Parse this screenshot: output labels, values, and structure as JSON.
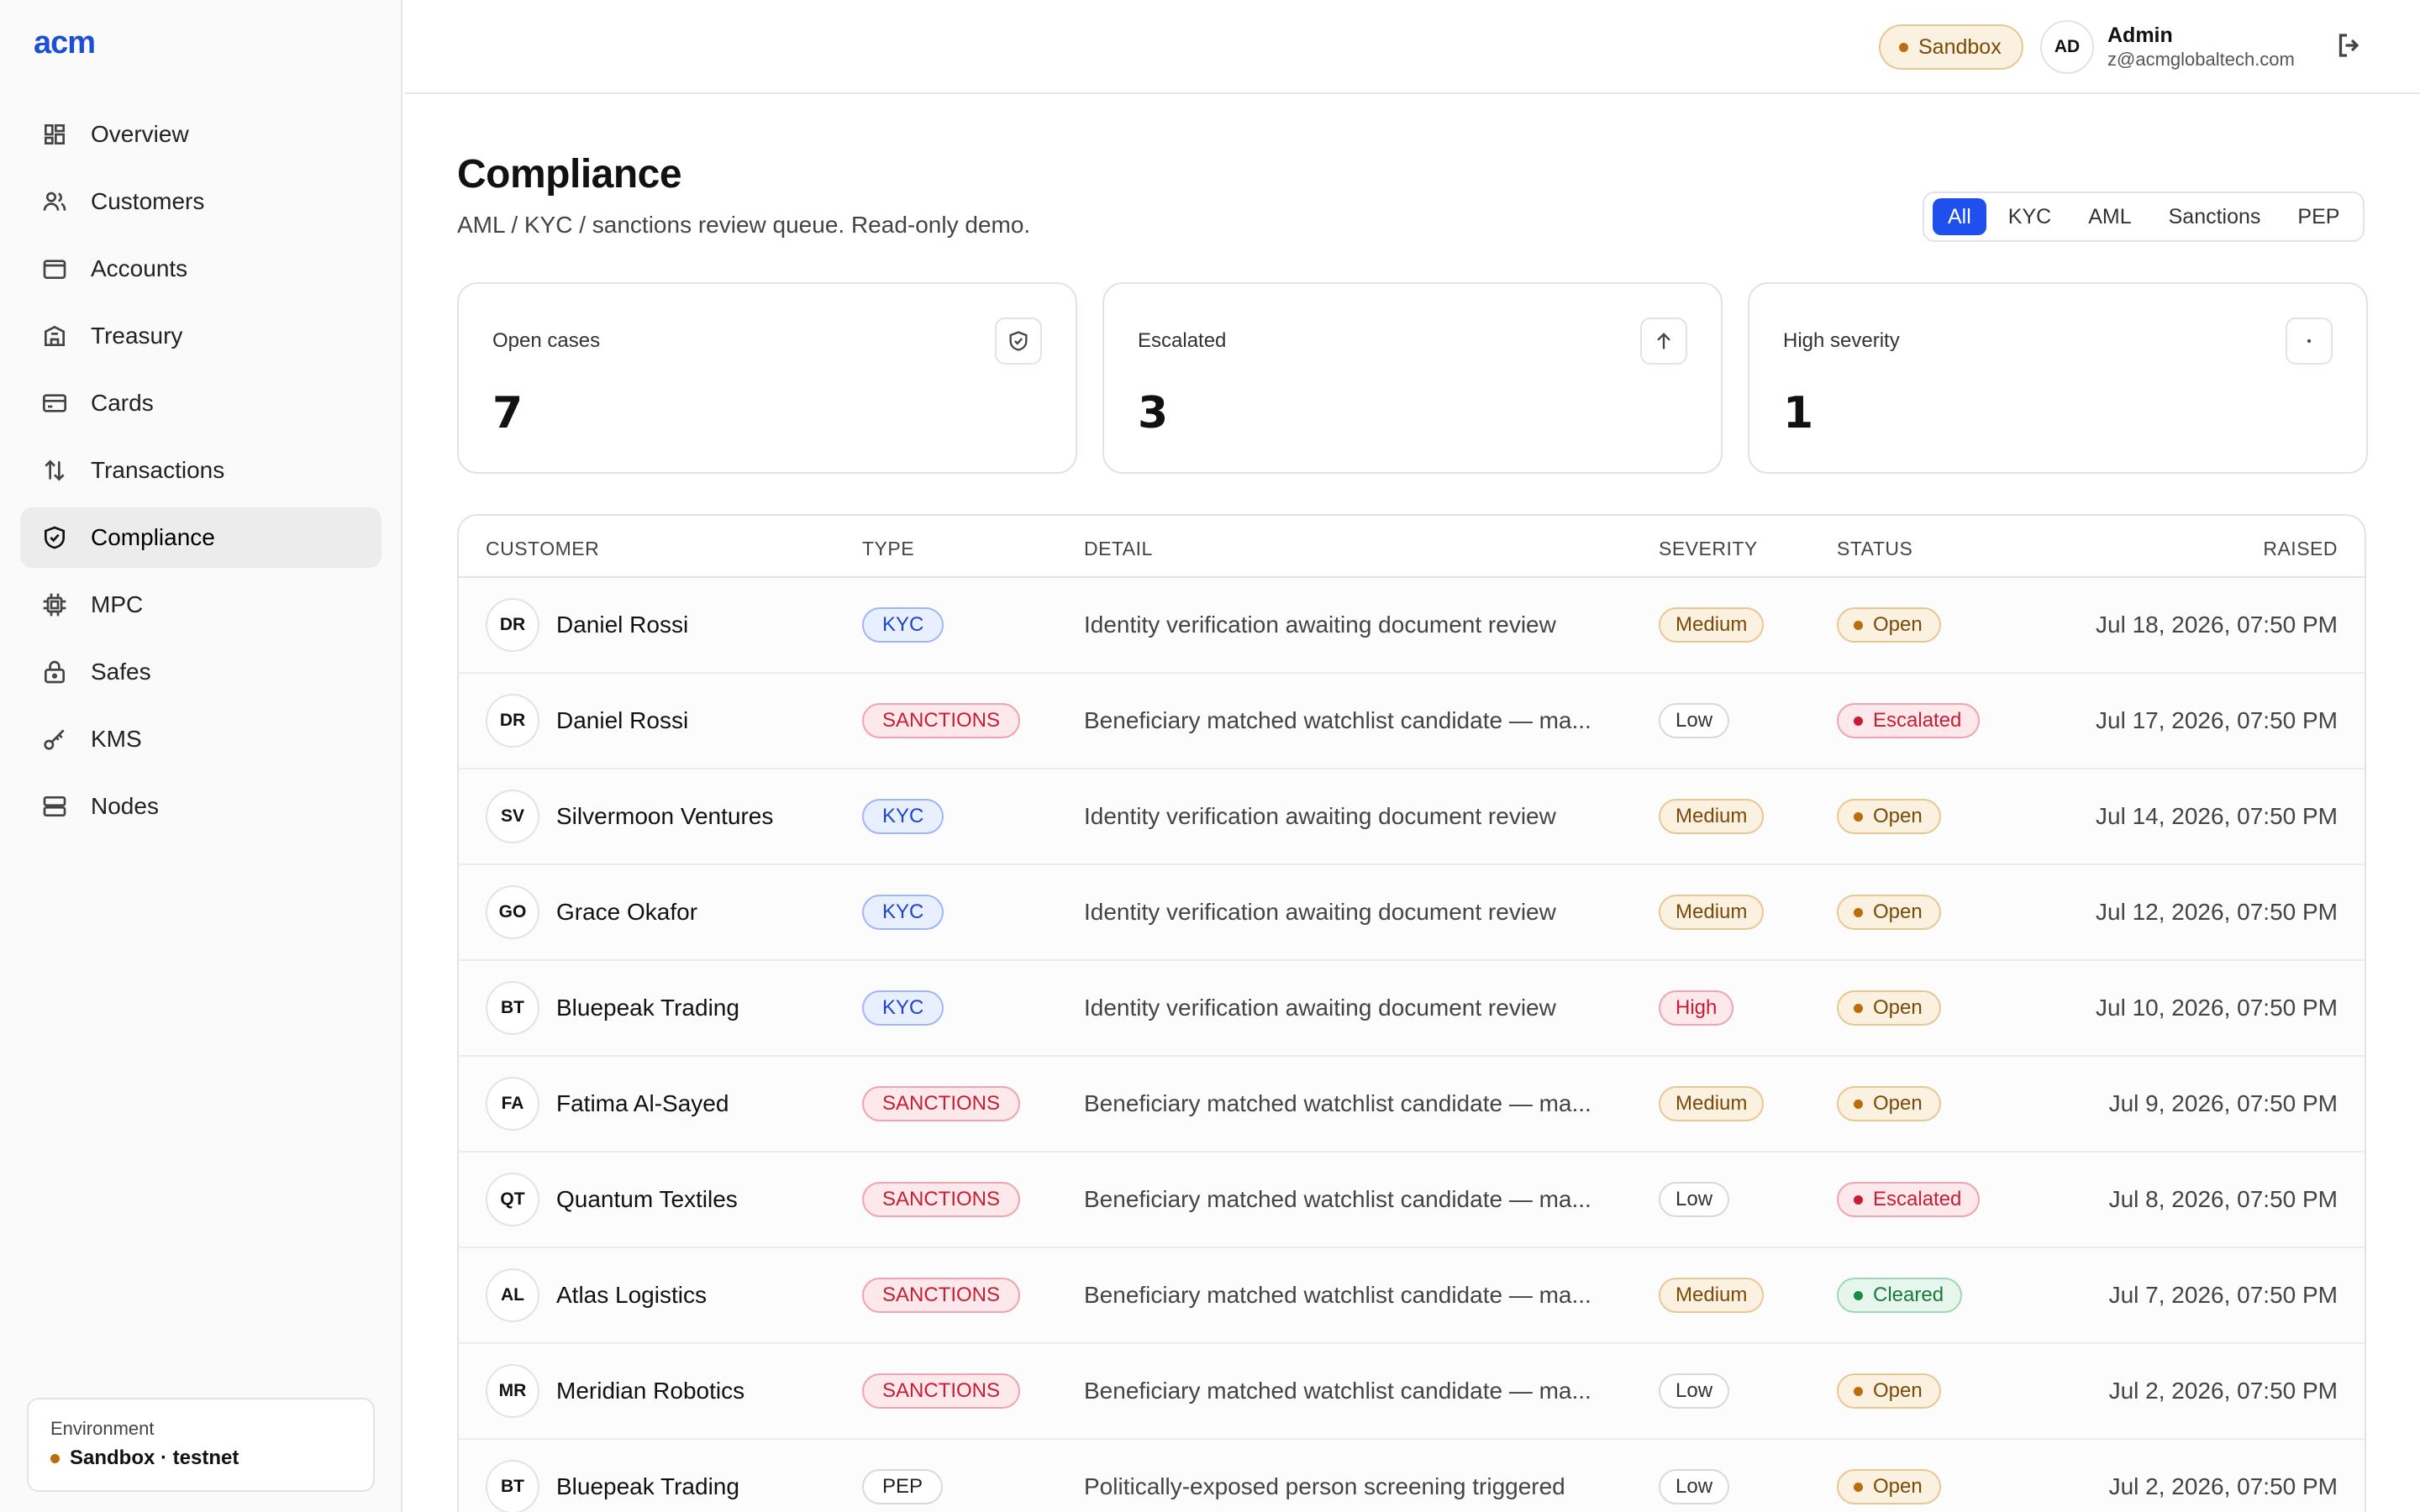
{
  "app": {
    "logo": "acm"
  },
  "sidebar": {
    "items": [
      {
        "label": "Overview",
        "icon": "dashboard-icon",
        "active": false
      },
      {
        "label": "Customers",
        "icon": "users-icon",
        "active": false
      },
      {
        "label": "Accounts",
        "icon": "wallet-icon",
        "active": false
      },
      {
        "label": "Treasury",
        "icon": "bank-icon",
        "active": false
      },
      {
        "label": "Cards",
        "icon": "credit-card-icon",
        "active": false
      },
      {
        "label": "Transactions",
        "icon": "arrows-up-down-icon",
        "active": false
      },
      {
        "label": "Compliance",
        "icon": "shield-check-icon",
        "active": true
      },
      {
        "label": "MPC",
        "icon": "chip-icon",
        "active": false
      },
      {
        "label": "Safes",
        "icon": "lock-icon",
        "active": false
      },
      {
        "label": "KMS",
        "icon": "key-icon",
        "active": false
      },
      {
        "label": "Nodes",
        "icon": "server-icon",
        "active": false
      }
    ],
    "environment": {
      "label": "Environment",
      "value": "Sandbox · testnet"
    }
  },
  "topbar": {
    "env_pill": "Sandbox",
    "user": {
      "initials": "AD",
      "name": "Admin",
      "email": "z@acmglobaltech.com"
    }
  },
  "page": {
    "title": "Compliance",
    "subtitle": "AML / KYC / sanctions review queue. Read-only demo.",
    "filters": [
      "All",
      "KYC",
      "AML",
      "Sanctions",
      "PEP"
    ],
    "active_filter": "All"
  },
  "stats": [
    {
      "label": "Open cases",
      "value": "7",
      "icon": "shield-check-icon"
    },
    {
      "label": "Escalated",
      "value": "3",
      "icon": "arrow-up-icon"
    },
    {
      "label": "High severity",
      "value": "1",
      "icon": "dot-icon"
    }
  ],
  "table": {
    "headers": {
      "customer": "CUSTOMER",
      "type": "TYPE",
      "detail": "DETAIL",
      "severity": "SEVERITY",
      "status": "STATUS",
      "raised": "RAISED"
    },
    "rows": [
      {
        "initials": "DR",
        "customer": "Daniel Rossi",
        "type": "KYC",
        "detail": "Identity verification awaiting document review",
        "severity": "Medium",
        "status": "Open",
        "raised": "Jul 18, 2026, 07:50 PM"
      },
      {
        "initials": "DR",
        "customer": "Daniel Rossi",
        "type": "SANCTIONS",
        "detail": "Beneficiary matched watchlist candidate — ma...",
        "severity": "Low",
        "status": "Escalated",
        "raised": "Jul 17, 2026, 07:50 PM"
      },
      {
        "initials": "SV",
        "customer": "Silvermoon Ventures",
        "type": "KYC",
        "detail": "Identity verification awaiting document review",
        "severity": "Medium",
        "status": "Open",
        "raised": "Jul 14, 2026, 07:50 PM"
      },
      {
        "initials": "GO",
        "customer": "Grace Okafor",
        "type": "KYC",
        "detail": "Identity verification awaiting document review",
        "severity": "Medium",
        "status": "Open",
        "raised": "Jul 12, 2026, 07:50 PM"
      },
      {
        "initials": "BT",
        "customer": "Bluepeak Trading",
        "type": "KYC",
        "detail": "Identity verification awaiting document review",
        "severity": "High",
        "status": "Open",
        "raised": "Jul 10, 2026, 07:50 PM"
      },
      {
        "initials": "FA",
        "customer": "Fatima Al-Sayed",
        "type": "SANCTIONS",
        "detail": "Beneficiary matched watchlist candidate — ma...",
        "severity": "Medium",
        "status": "Open",
        "raised": "Jul 9, 2026, 07:50 PM"
      },
      {
        "initials": "QT",
        "customer": "Quantum Textiles",
        "type": "SANCTIONS",
        "detail": "Beneficiary matched watchlist candidate — ma...",
        "severity": "Low",
        "status": "Escalated",
        "raised": "Jul 8, 2026, 07:50 PM"
      },
      {
        "initials": "AL",
        "customer": "Atlas Logistics",
        "type": "SANCTIONS",
        "detail": "Beneficiary matched watchlist candidate — ma...",
        "severity": "Medium",
        "status": "Cleared",
        "raised": "Jul 7, 2026, 07:50 PM"
      },
      {
        "initials": "MR",
        "customer": "Meridian Robotics",
        "type": "SANCTIONS",
        "detail": "Beneficiary matched watchlist candidate — ma...",
        "severity": "Low",
        "status": "Open",
        "raised": "Jul 2, 2026, 07:50 PM"
      },
      {
        "initials": "BT",
        "customer": "Bluepeak Trading",
        "type": "PEP",
        "detail": "Politically-exposed person screening triggered",
        "severity": "Low",
        "status": "Open",
        "raised": "Jul 2, 2026, 07:50 PM"
      }
    ]
  },
  "colors": {
    "accent": "#1f50ee",
    "logo": "#1d4ed8",
    "warning": "#b96d0b",
    "danger": "#c81d34",
    "success": "#1b8a45"
  }
}
